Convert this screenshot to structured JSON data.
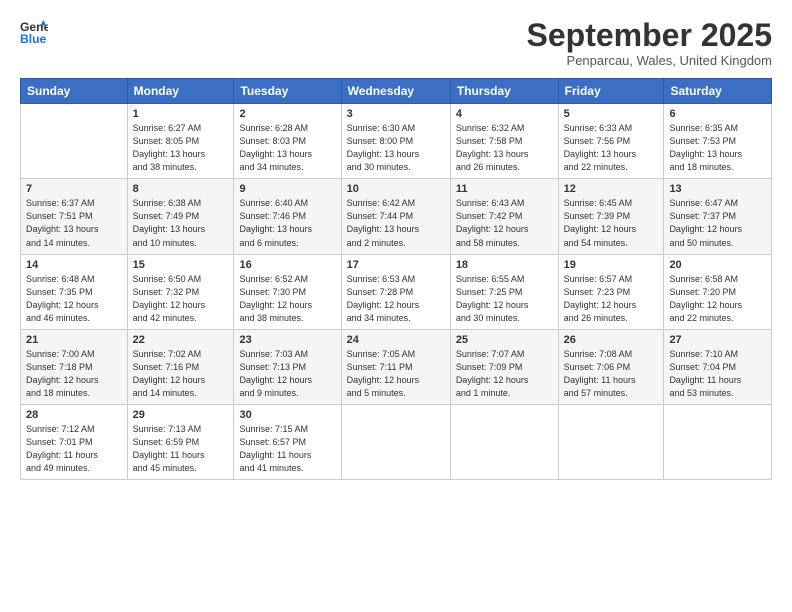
{
  "header": {
    "logo_line1": "General",
    "logo_line2": "Blue",
    "month_title": "September 2025",
    "location": "Penparcau, Wales, United Kingdom"
  },
  "days_of_week": [
    "Sunday",
    "Monday",
    "Tuesday",
    "Wednesday",
    "Thursday",
    "Friday",
    "Saturday"
  ],
  "weeks": [
    [
      {
        "day": "",
        "content": ""
      },
      {
        "day": "1",
        "content": "Sunrise: 6:27 AM\nSunset: 8:05 PM\nDaylight: 13 hours\nand 38 minutes."
      },
      {
        "day": "2",
        "content": "Sunrise: 6:28 AM\nSunset: 8:03 PM\nDaylight: 13 hours\nand 34 minutes."
      },
      {
        "day": "3",
        "content": "Sunrise: 6:30 AM\nSunset: 8:00 PM\nDaylight: 13 hours\nand 30 minutes."
      },
      {
        "day": "4",
        "content": "Sunrise: 6:32 AM\nSunset: 7:58 PM\nDaylight: 13 hours\nand 26 minutes."
      },
      {
        "day": "5",
        "content": "Sunrise: 6:33 AM\nSunset: 7:56 PM\nDaylight: 13 hours\nand 22 minutes."
      },
      {
        "day": "6",
        "content": "Sunrise: 6:35 AM\nSunset: 7:53 PM\nDaylight: 13 hours\nand 18 minutes."
      }
    ],
    [
      {
        "day": "7",
        "content": "Sunrise: 6:37 AM\nSunset: 7:51 PM\nDaylight: 13 hours\nand 14 minutes."
      },
      {
        "day": "8",
        "content": "Sunrise: 6:38 AM\nSunset: 7:49 PM\nDaylight: 13 hours\nand 10 minutes."
      },
      {
        "day": "9",
        "content": "Sunrise: 6:40 AM\nSunset: 7:46 PM\nDaylight: 13 hours\nand 6 minutes."
      },
      {
        "day": "10",
        "content": "Sunrise: 6:42 AM\nSunset: 7:44 PM\nDaylight: 13 hours\nand 2 minutes."
      },
      {
        "day": "11",
        "content": "Sunrise: 6:43 AM\nSunset: 7:42 PM\nDaylight: 12 hours\nand 58 minutes."
      },
      {
        "day": "12",
        "content": "Sunrise: 6:45 AM\nSunset: 7:39 PM\nDaylight: 12 hours\nand 54 minutes."
      },
      {
        "day": "13",
        "content": "Sunrise: 6:47 AM\nSunset: 7:37 PM\nDaylight: 12 hours\nand 50 minutes."
      }
    ],
    [
      {
        "day": "14",
        "content": "Sunrise: 6:48 AM\nSunset: 7:35 PM\nDaylight: 12 hours\nand 46 minutes."
      },
      {
        "day": "15",
        "content": "Sunrise: 6:50 AM\nSunset: 7:32 PM\nDaylight: 12 hours\nand 42 minutes."
      },
      {
        "day": "16",
        "content": "Sunrise: 6:52 AM\nSunset: 7:30 PM\nDaylight: 12 hours\nand 38 minutes."
      },
      {
        "day": "17",
        "content": "Sunrise: 6:53 AM\nSunset: 7:28 PM\nDaylight: 12 hours\nand 34 minutes."
      },
      {
        "day": "18",
        "content": "Sunrise: 6:55 AM\nSunset: 7:25 PM\nDaylight: 12 hours\nand 30 minutes."
      },
      {
        "day": "19",
        "content": "Sunrise: 6:57 AM\nSunset: 7:23 PM\nDaylight: 12 hours\nand 26 minutes."
      },
      {
        "day": "20",
        "content": "Sunrise: 6:58 AM\nSunset: 7:20 PM\nDaylight: 12 hours\nand 22 minutes."
      }
    ],
    [
      {
        "day": "21",
        "content": "Sunrise: 7:00 AM\nSunset: 7:18 PM\nDaylight: 12 hours\nand 18 minutes."
      },
      {
        "day": "22",
        "content": "Sunrise: 7:02 AM\nSunset: 7:16 PM\nDaylight: 12 hours\nand 14 minutes."
      },
      {
        "day": "23",
        "content": "Sunrise: 7:03 AM\nSunset: 7:13 PM\nDaylight: 12 hours\nand 9 minutes."
      },
      {
        "day": "24",
        "content": "Sunrise: 7:05 AM\nSunset: 7:11 PM\nDaylight: 12 hours\nand 5 minutes."
      },
      {
        "day": "25",
        "content": "Sunrise: 7:07 AM\nSunset: 7:09 PM\nDaylight: 12 hours\nand 1 minute."
      },
      {
        "day": "26",
        "content": "Sunrise: 7:08 AM\nSunset: 7:06 PM\nDaylight: 11 hours\nand 57 minutes."
      },
      {
        "day": "27",
        "content": "Sunrise: 7:10 AM\nSunset: 7:04 PM\nDaylight: 11 hours\nand 53 minutes."
      }
    ],
    [
      {
        "day": "28",
        "content": "Sunrise: 7:12 AM\nSunset: 7:01 PM\nDaylight: 11 hours\nand 49 minutes."
      },
      {
        "day": "29",
        "content": "Sunrise: 7:13 AM\nSunset: 6:59 PM\nDaylight: 11 hours\nand 45 minutes."
      },
      {
        "day": "30",
        "content": "Sunrise: 7:15 AM\nSunset: 6:57 PM\nDaylight: 11 hours\nand 41 minutes."
      },
      {
        "day": "",
        "content": ""
      },
      {
        "day": "",
        "content": ""
      },
      {
        "day": "",
        "content": ""
      },
      {
        "day": "",
        "content": ""
      }
    ]
  ]
}
